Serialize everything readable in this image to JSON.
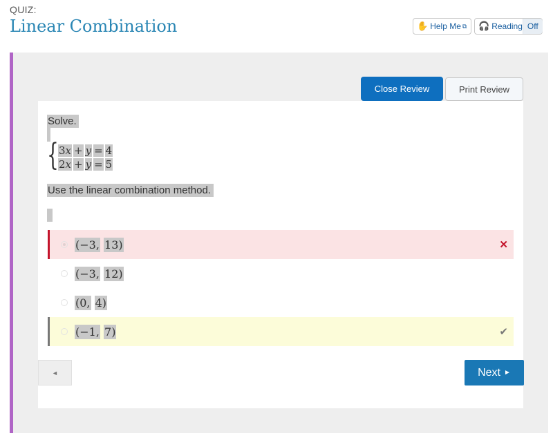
{
  "header": {
    "quiz_label": "QUIZ:",
    "title": "Linear Combination",
    "help_button": {
      "label": "Help Me",
      "icon": "hand-icon",
      "ext_icon": "external-window-icon"
    },
    "reading_button": {
      "label": "Reading",
      "state": "Off",
      "icon": "headphones-icon"
    }
  },
  "review": {
    "close_label": "Close Review",
    "print_label": "Print Review"
  },
  "question": {
    "prompt": "Solve.",
    "equations": [
      {
        "lhs_coef": "3",
        "var1": "x",
        "op": "+",
        "var2": "y",
        "eq": "=",
        "rhs": "4"
      },
      {
        "lhs_coef": "2",
        "var1": "x",
        "op": "+",
        "var2": "y",
        "eq": "=",
        "rhs": "5"
      }
    ],
    "instruction": "Use the linear combination method."
  },
  "choices": [
    {
      "a": "(−3,",
      "b": "13)",
      "status": "incorrect",
      "selected": true,
      "mark": "✕"
    },
    {
      "a": "(−3,",
      "b": "12)",
      "status": "none",
      "selected": false,
      "mark": ""
    },
    {
      "a": "(0,",
      "b": "4)",
      "status": "none",
      "selected": false,
      "mark": ""
    },
    {
      "a": "(−1,",
      "b": "7)",
      "status": "correct",
      "selected": false,
      "mark": "✔"
    }
  ],
  "navigation": {
    "prev_icon": "◄",
    "next_label": "Next",
    "next_icon": "►"
  },
  "colors": {
    "title": "#2a86b4",
    "accent_purple": "#b065c6",
    "primary_button": "#0e6fbf",
    "next_button": "#1a78b5",
    "incorrect_bg": "#fbe3e4",
    "incorrect_border": "#c4142c",
    "correct_bg": "#fcfcd9"
  }
}
